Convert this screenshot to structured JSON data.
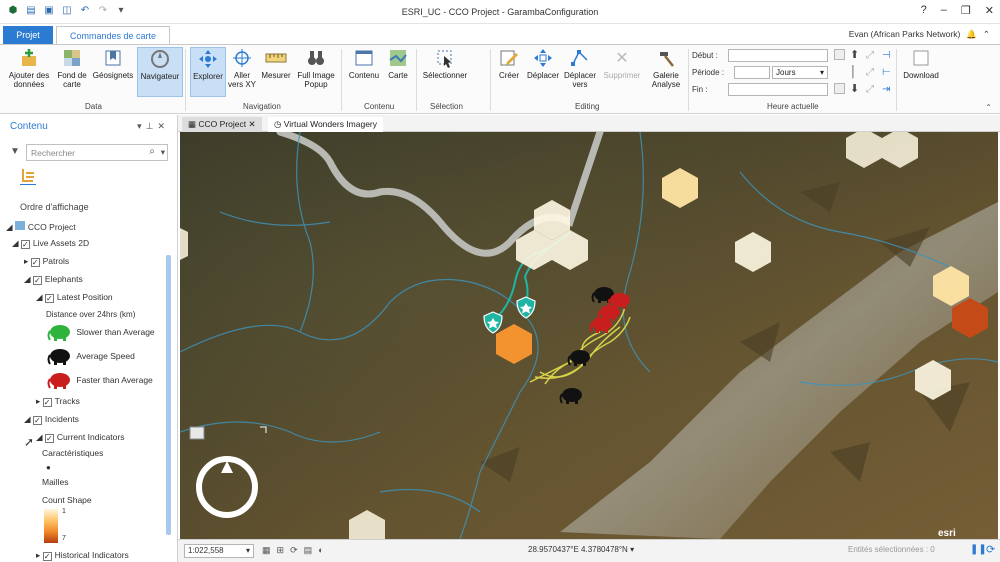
{
  "window": {
    "title": "ESRI_UC - CCO Project - GarambaConfiguration",
    "user": "Evan (African Parks Network)",
    "help": "?",
    "controls": [
      "–",
      "❐",
      "✕"
    ]
  },
  "tabs": {
    "projet": "Projet",
    "active": "Commandes de carte"
  },
  "ribbon": {
    "buttons": {
      "add_data": "Ajouter des données",
      "basemap": "Fond de carte",
      "bookmarks": "Géosignets",
      "navigator": "Navigateur",
      "explore": "Explorer",
      "goto_xy": "Aller vers XY",
      "measure": "Mesurer",
      "popup": "Full Image Popup",
      "content": "Contenu",
      "map": "Carte",
      "select": "Sélectionner",
      "create": "Créer",
      "move": "Déplacer",
      "move_vertices": "Déplacer vers",
      "delete": "Supprimer",
      "gallery": "Galerie Analyse",
      "download": "Download"
    },
    "groups": {
      "data": "Data",
      "navigation": "Navigation",
      "content": "Contenu",
      "selection": "Sélection",
      "editing": "Editing",
      "current_time": "Heure actuelle"
    },
    "time": {
      "start": "Début :",
      "period": "Période :",
      "period_unit": "Jours",
      "end": "Fin :"
    }
  },
  "content_pane": {
    "title": "Contenu",
    "search_placeholder": "Rechercher",
    "display_order": "Ordre d'affichage",
    "tree": {
      "project": "CCO Project",
      "live_assets": "Live Assets 2D",
      "patrols": "Patrols",
      "elephants": "Elephants",
      "latest_position": "Latest Position",
      "distance_label": "Distance over 24hrs (km)",
      "slower": "Slower than Average",
      "average": "Average Speed",
      "faster": "Faster than Average",
      "tracks": "Tracks",
      "incidents": "Incidents",
      "current_indicators": "Current Indicators",
      "characteristics": "Caractéristiques",
      "cells": "Mailles",
      "count_shape": "Count Shape",
      "legend_max": "1",
      "legend_min": "7",
      "historical": "Historical Indicators"
    }
  },
  "map": {
    "tabs": {
      "cco": "CCO Project",
      "imagery": "Virtual Wonders Imagery"
    }
  },
  "status": {
    "scale": "1:022,558",
    "coordinates": "28.9570437°E 4.3780478°N",
    "selected": "Entités sélectionnées : 0",
    "logo": "esri"
  },
  "colors": {
    "accent": "#2c7bd3",
    "river": "#3e92b8",
    "border_line": "#b9b9b4",
    "patrol": "#1fb5a2",
    "track": "#d6d34a",
    "elephant_fast": "#c81e1e",
    "elephant_avg": "#111111",
    "elephant_slow": "#2fb33c",
    "hex_low": "#fff8e3",
    "hex_mid": "#ffe4a3",
    "hex_high": "#f39330",
    "hex_top": "#c44b17"
  }
}
